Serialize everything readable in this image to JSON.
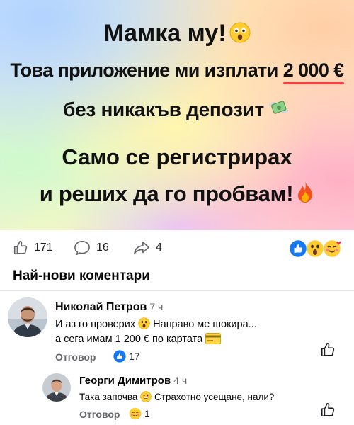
{
  "hero": {
    "line1": "Мамка му!",
    "line2_prefix": "Това приложение ми изплати ",
    "line2_amount": "2 000 €",
    "line3": "без никакъв депозит",
    "line4": "Само се регистрирах",
    "line5": "и реших да го пробвам!",
    "accent_underline_color": "#ff3b45"
  },
  "stats": {
    "likes": "171",
    "comments": "16",
    "shares": "4",
    "reactions": [
      "like-icon",
      "wow-icon",
      "love-face-icon"
    ]
  },
  "comments_section": {
    "title": "Най-нови коментари",
    "comments": [
      {
        "author": "Николай Петров",
        "time": "7 ч",
        "line1": "И аз го проверих",
        "line1_after": "Направо ме шокира...",
        "line2": "а сега имам 1 200 € по картата",
        "reply_label": "Отговор",
        "reaction_count": "17",
        "reaction_icon": "like-icon"
      },
      {
        "author": "Георги Димитров",
        "time": "4 ч",
        "line1": "Така започва",
        "line1_after": "Страхотно усещане, нали?",
        "reply_label": "Отговор",
        "reaction_count": "1",
        "reaction_icon": "love-face-icon"
      }
    ]
  },
  "colors": {
    "facebook_blue": "#1877f2",
    "muted_text": "#65676b"
  }
}
